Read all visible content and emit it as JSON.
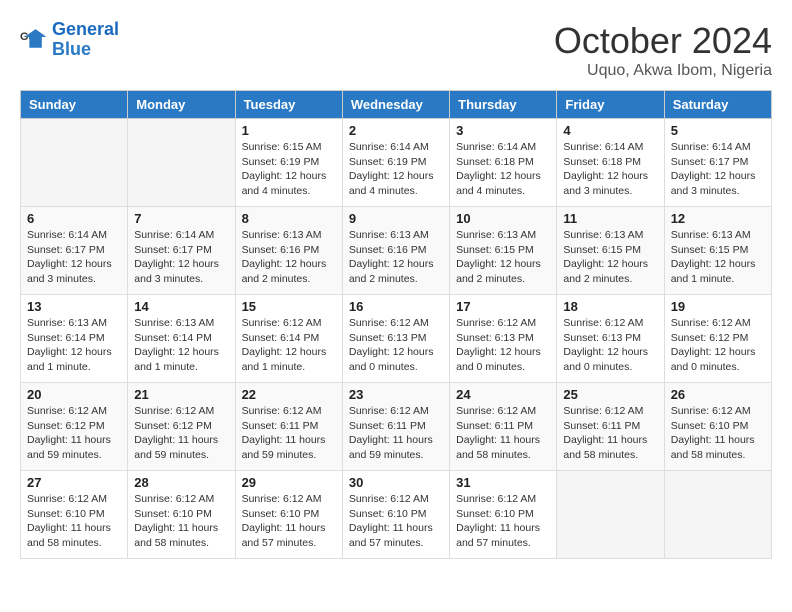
{
  "logo": {
    "line1": "General",
    "line2": "Blue"
  },
  "title": "October 2024",
  "location": "Uquo, Akwa Ibom, Nigeria",
  "days_of_week": [
    "Sunday",
    "Monday",
    "Tuesday",
    "Wednesday",
    "Thursday",
    "Friday",
    "Saturday"
  ],
  "weeks": [
    [
      {
        "day": "",
        "info": ""
      },
      {
        "day": "",
        "info": ""
      },
      {
        "day": "1",
        "info": "Sunrise: 6:15 AM\nSunset: 6:19 PM\nDaylight: 12 hours\nand 4 minutes."
      },
      {
        "day": "2",
        "info": "Sunrise: 6:14 AM\nSunset: 6:19 PM\nDaylight: 12 hours\nand 4 minutes."
      },
      {
        "day": "3",
        "info": "Sunrise: 6:14 AM\nSunset: 6:18 PM\nDaylight: 12 hours\nand 4 minutes."
      },
      {
        "day": "4",
        "info": "Sunrise: 6:14 AM\nSunset: 6:18 PM\nDaylight: 12 hours\nand 3 minutes."
      },
      {
        "day": "5",
        "info": "Sunrise: 6:14 AM\nSunset: 6:17 PM\nDaylight: 12 hours\nand 3 minutes."
      }
    ],
    [
      {
        "day": "6",
        "info": "Sunrise: 6:14 AM\nSunset: 6:17 PM\nDaylight: 12 hours\nand 3 minutes."
      },
      {
        "day": "7",
        "info": "Sunrise: 6:14 AM\nSunset: 6:17 PM\nDaylight: 12 hours\nand 3 minutes."
      },
      {
        "day": "8",
        "info": "Sunrise: 6:13 AM\nSunset: 6:16 PM\nDaylight: 12 hours\nand 2 minutes."
      },
      {
        "day": "9",
        "info": "Sunrise: 6:13 AM\nSunset: 6:16 PM\nDaylight: 12 hours\nand 2 minutes."
      },
      {
        "day": "10",
        "info": "Sunrise: 6:13 AM\nSunset: 6:15 PM\nDaylight: 12 hours\nand 2 minutes."
      },
      {
        "day": "11",
        "info": "Sunrise: 6:13 AM\nSunset: 6:15 PM\nDaylight: 12 hours\nand 2 minutes."
      },
      {
        "day": "12",
        "info": "Sunrise: 6:13 AM\nSunset: 6:15 PM\nDaylight: 12 hours\nand 1 minute."
      }
    ],
    [
      {
        "day": "13",
        "info": "Sunrise: 6:13 AM\nSunset: 6:14 PM\nDaylight: 12 hours\nand 1 minute."
      },
      {
        "day": "14",
        "info": "Sunrise: 6:13 AM\nSunset: 6:14 PM\nDaylight: 12 hours\nand 1 minute."
      },
      {
        "day": "15",
        "info": "Sunrise: 6:12 AM\nSunset: 6:14 PM\nDaylight: 12 hours\nand 1 minute."
      },
      {
        "day": "16",
        "info": "Sunrise: 6:12 AM\nSunset: 6:13 PM\nDaylight: 12 hours\nand 0 minutes."
      },
      {
        "day": "17",
        "info": "Sunrise: 6:12 AM\nSunset: 6:13 PM\nDaylight: 12 hours\nand 0 minutes."
      },
      {
        "day": "18",
        "info": "Sunrise: 6:12 AM\nSunset: 6:13 PM\nDaylight: 12 hours\nand 0 minutes."
      },
      {
        "day": "19",
        "info": "Sunrise: 6:12 AM\nSunset: 6:12 PM\nDaylight: 12 hours\nand 0 minutes."
      }
    ],
    [
      {
        "day": "20",
        "info": "Sunrise: 6:12 AM\nSunset: 6:12 PM\nDaylight: 11 hours\nand 59 minutes."
      },
      {
        "day": "21",
        "info": "Sunrise: 6:12 AM\nSunset: 6:12 PM\nDaylight: 11 hours\nand 59 minutes."
      },
      {
        "day": "22",
        "info": "Sunrise: 6:12 AM\nSunset: 6:11 PM\nDaylight: 11 hours\nand 59 minutes."
      },
      {
        "day": "23",
        "info": "Sunrise: 6:12 AM\nSunset: 6:11 PM\nDaylight: 11 hours\nand 59 minutes."
      },
      {
        "day": "24",
        "info": "Sunrise: 6:12 AM\nSunset: 6:11 PM\nDaylight: 11 hours\nand 58 minutes."
      },
      {
        "day": "25",
        "info": "Sunrise: 6:12 AM\nSunset: 6:11 PM\nDaylight: 11 hours\nand 58 minutes."
      },
      {
        "day": "26",
        "info": "Sunrise: 6:12 AM\nSunset: 6:10 PM\nDaylight: 11 hours\nand 58 minutes."
      }
    ],
    [
      {
        "day": "27",
        "info": "Sunrise: 6:12 AM\nSunset: 6:10 PM\nDaylight: 11 hours\nand 58 minutes."
      },
      {
        "day": "28",
        "info": "Sunrise: 6:12 AM\nSunset: 6:10 PM\nDaylight: 11 hours\nand 58 minutes."
      },
      {
        "day": "29",
        "info": "Sunrise: 6:12 AM\nSunset: 6:10 PM\nDaylight: 11 hours\nand 57 minutes."
      },
      {
        "day": "30",
        "info": "Sunrise: 6:12 AM\nSunset: 6:10 PM\nDaylight: 11 hours\nand 57 minutes."
      },
      {
        "day": "31",
        "info": "Sunrise: 6:12 AM\nSunset: 6:10 PM\nDaylight: 11 hours\nand 57 minutes."
      },
      {
        "day": "",
        "info": ""
      },
      {
        "day": "",
        "info": ""
      }
    ]
  ]
}
